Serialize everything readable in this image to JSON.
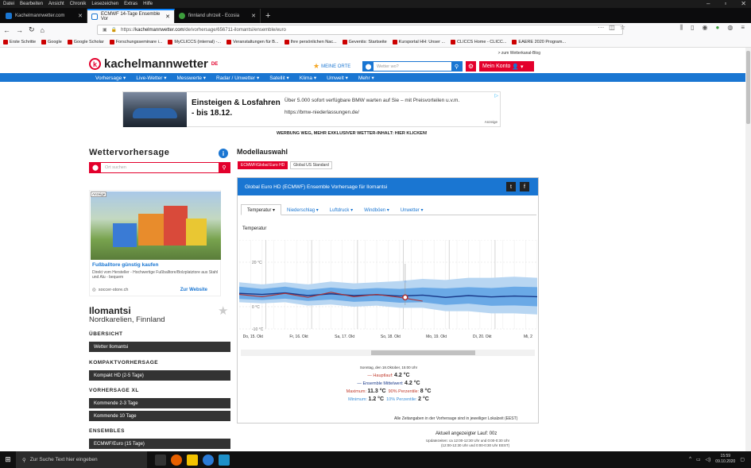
{
  "menubar": [
    "Datei",
    "Bearbeiten",
    "Ansicht",
    "Chronik",
    "Lesezeichen",
    "Extras",
    "Hilfe"
  ],
  "tabs": [
    {
      "title": "Kachelmannwetter.com",
      "active": false
    },
    {
      "title": "ECMWF 14-Tage Ensemble Vor",
      "active": true
    },
    {
      "title": "finnland uhrzeit - Ecosia",
      "active": false
    }
  ],
  "url": {
    "prefix": "https://",
    "domain": "kachelmannwetter.com",
    "path": "/de/vorhersage/656711-ilomantsi/ensemble/euro"
  },
  "bookmarks": [
    "Erste Schritte",
    "Google",
    "Google Scholar",
    "Forschungsseminare i...",
    "MyCLICCS (internal) -...",
    "Veranstaltungen für B...",
    "Ihre persönlichen Nac...",
    "Geventis: Startseite",
    "Kursportal HH: Unser ...",
    "CLICCS Home - CLICC...",
    "EAERE 2020 Program..."
  ],
  "site": {
    "logo": "kachelmannwetter",
    "logo_sup": "DE",
    "blog_link": "> zum Wetterkanal-Blog",
    "meine_orte": "MEINE ORTE",
    "search_placeholder": "Wetter wo?",
    "konto": "Mein Konto"
  },
  "mainnav": [
    "Vorhersage ▾",
    "Live-Wetter ▾",
    "Messwerte ▾",
    "Radar / Unwetter ▾",
    "Satellit ▾",
    "Klima ▾",
    "Umwelt ▾",
    "Mehr ▾"
  ],
  "ad": {
    "title": "Einsteigen & Losfahren - bis 18.12.",
    "text": "Über 5.000 sofort verfügbare BMW warten auf Sie – mit Preisvorteilen u.v.m.",
    "url": "https://bmw-niederlassungen.de/",
    "anzeige": "Anzeige"
  },
  "werbung": "WERBUNG WEG, MEHR EXKLUSIVER WETTER-INHALT: HIER KLICKEN!",
  "left": {
    "title": "Wettervorhersage",
    "search_placeholder": "Ort suchen",
    "ad": {
      "anzeige": "Anzeige",
      "title": "Fußballtore günstig kaufen",
      "text": "Direkt vom Hersteller - Hochwertige Fußballtore/Bolzplatztore aus Stahl und Alu - bequem",
      "source": "soccer-store.ch",
      "button": "Zur Website"
    },
    "place": "Ilomantsi",
    "region": "Nordkarelien, Finnland",
    "sections": [
      {
        "heading": "ÜBERSICHT",
        "items": [
          "Wetter Ilomantsi"
        ]
      },
      {
        "heading": "KOMPAKTVORHERSAGE",
        "items": [
          "Kompakt HD (2-5 Tage)"
        ]
      },
      {
        "heading": "VORHERSAGE XL",
        "items": [
          "Kommende 2-3 Tage",
          "Kommende 10 Tage"
        ]
      },
      {
        "heading": "ENSEMBLES",
        "items": [
          "ECMWF/Euro (15 Tage)"
        ]
      }
    ]
  },
  "model": {
    "title": "Modellauswahl",
    "buttons": [
      "ECMWF/Global Euro HD",
      "Global US Standard"
    ],
    "panel_title": "Global Euro HD (ECMWF) Ensemble Vorhersage für Ilomantsi",
    "tabs": [
      "Temperatur ▾",
      "Niederschlag ▾",
      "Luftdruck ▾",
      "Windböen ▾",
      "Unwetter ▾"
    ],
    "chart_label": "Temperatur"
  },
  "chart_data": {
    "type": "line",
    "y_ticks": [
      "20 °C",
      "0 °C",
      "-10 °C"
    ],
    "x_ticks": [
      "Do, 15. Okt",
      "Fr, 16. Okt",
      "Sa, 17. Okt",
      "So, 18. Okt",
      "Mo, 19. Okt",
      "Di, 20. Okt",
      "Mi, 2"
    ],
    "ylim": [
      -10,
      30
    ],
    "days": [
      0,
      0.5,
      1,
      1.5,
      2,
      2.5,
      3,
      3.5,
      4,
      4.5,
      5,
      5.5,
      6,
      6.5
    ],
    "ensemble_mean": [
      6.0,
      5.5,
      6.2,
      5.0,
      5.8,
      5.0,
      5.4,
      4.8,
      5.2,
      4.2,
      5.0,
      4.4,
      4.8,
      4.5
    ],
    "p10": [
      3.5,
      3.0,
      3.6,
      2.6,
      3.2,
      2.2,
      2.6,
      1.8,
      2.0,
      0.8,
      1.4,
      0.4,
      0.6,
      0.2
    ],
    "p90": [
      9.0,
      8.0,
      9.0,
      7.6,
      8.6,
      7.8,
      8.4,
      8.0,
      8.6,
      8.2,
      8.8,
      8.4,
      9.0,
      8.8
    ],
    "min": [
      2.0,
      1.5,
      2.0,
      0.5,
      1.0,
      0.0,
      0.5,
      -0.5,
      -0.5,
      -2.0,
      -2.0,
      -3.0,
      -3.0,
      -3.5
    ],
    "max": [
      11.0,
      10.0,
      11.0,
      10.0,
      11.3,
      10.5,
      11.0,
      11.5,
      12.5,
      12.0,
      13.0,
      13.0,
      13.5,
      13.0
    ],
    "hauptlauf_days": [
      0,
      0.5,
      1,
      1.5,
      2,
      2.5,
      3,
      3.5,
      4
    ],
    "hauptlauf": [
      5.5,
      4.5,
      6.0,
      4.2,
      6.5,
      4.5,
      5.5,
      4.2,
      2.5
    ]
  },
  "infobox": {
    "time": "Sonntag, den 18.Oktober, 15:00 Uhr",
    "hauptlauf_label": "— Hauptlauf:",
    "hauptlauf_value": "4.2 °C",
    "mittel_label": "— Ensemble Mittelwert:",
    "mittel_value": "4.2 °C",
    "max_label": "Maximum:",
    "max_value": "11.3 °C",
    "p90_label": "90% Perzentile:",
    "p90_value": "8 °C",
    "min_label": "Minimum:",
    "min_value": "1.2 °C",
    "p10_label": "10% Perzentile:",
    "p10_value": "2 °C"
  },
  "footer": {
    "zeit": "Alle Zeitangaben in der Vorhersage sind in jeweiliger Lokalzeit (EEST)",
    "lauf": "Aktuell angezeigter Lauf: 00z",
    "update1": "Updatezeiten: ca 12:00-12:30 Uhr und 0:00-0:30 Uhr",
    "update2": "(12:00-12:30 Uhr und 0:00-0:30 Uhr EEST)"
  },
  "taskbar": {
    "search": "Zur Suche Text hier eingeben",
    "time": "15:59",
    "date": "09.10.2020"
  }
}
